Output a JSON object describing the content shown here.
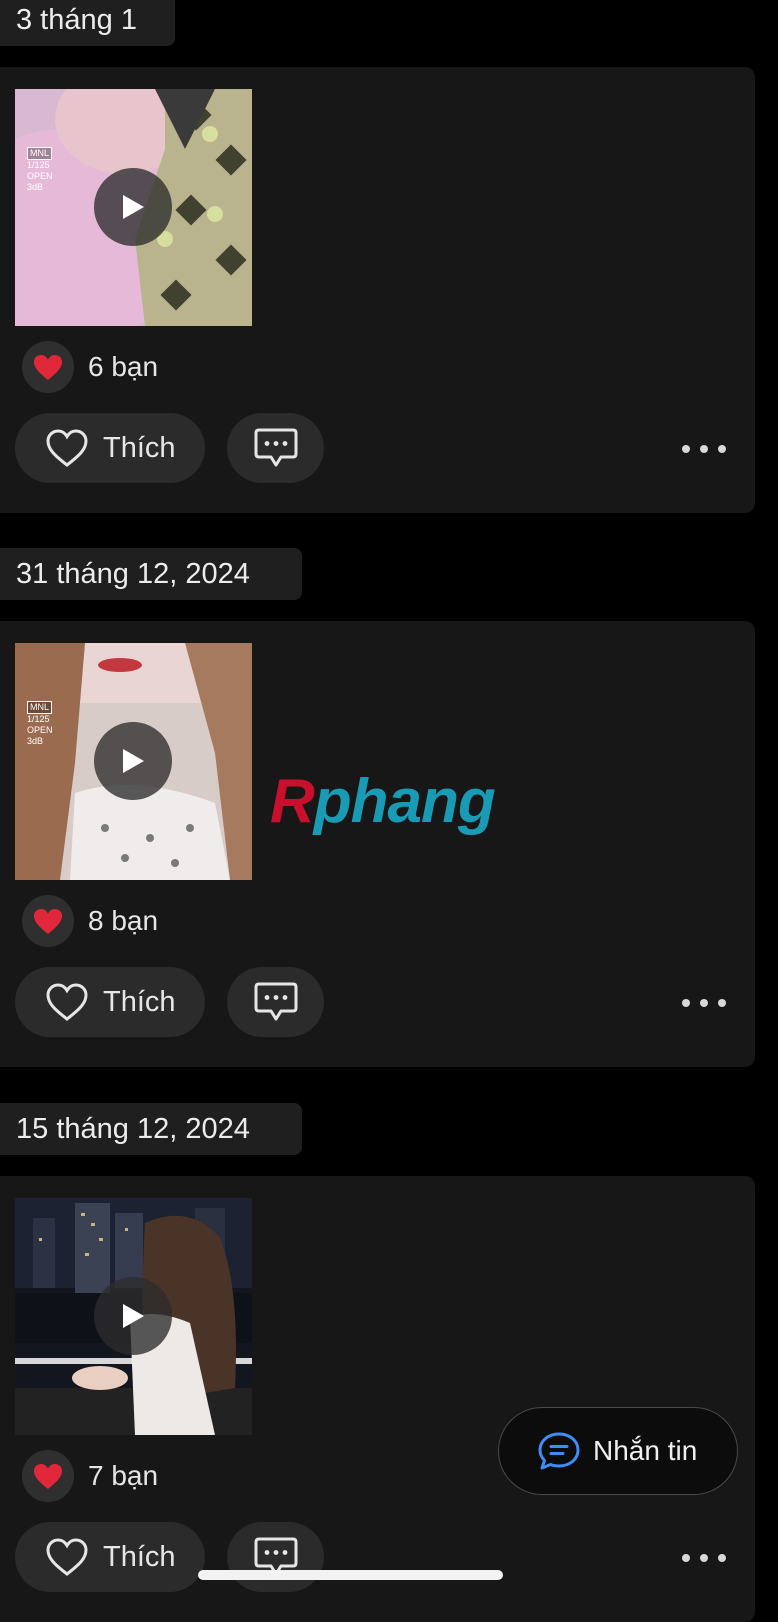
{
  "posts": [
    {
      "date": "3 tháng 1",
      "camera_overlay": [
        "MNL",
        "1/125",
        "OPEN",
        "3dB"
      ],
      "reaction_count": "6 bạn",
      "like_label": "Thích"
    },
    {
      "date": "31 tháng 12, 2024",
      "camera_overlay": [
        "MNL",
        "1/125",
        "OPEN",
        "3dB"
      ],
      "reaction_count": "8 bạn",
      "like_label": "Thích"
    },
    {
      "date": "15 tháng 12, 2024",
      "camera_overlay": [],
      "reaction_count": "7 bạn",
      "like_label": "Thích"
    }
  ],
  "watermark": {
    "first_letter": "R",
    "rest": "phang"
  },
  "message_button": {
    "label": "Nhắn tin"
  },
  "icons": {
    "reaction": "heart-emoji-icon",
    "like": "heart-outline-icon",
    "comment": "comment-bubble-icon",
    "more": "more-dots-icon",
    "play": "play-icon",
    "message": "chat-bubble-icon"
  },
  "colors": {
    "background": "#000000",
    "card": "#171717",
    "button": "#2b2b2b",
    "reaction_heart": "#e0283a",
    "message_icon": "#3d8ef5"
  }
}
